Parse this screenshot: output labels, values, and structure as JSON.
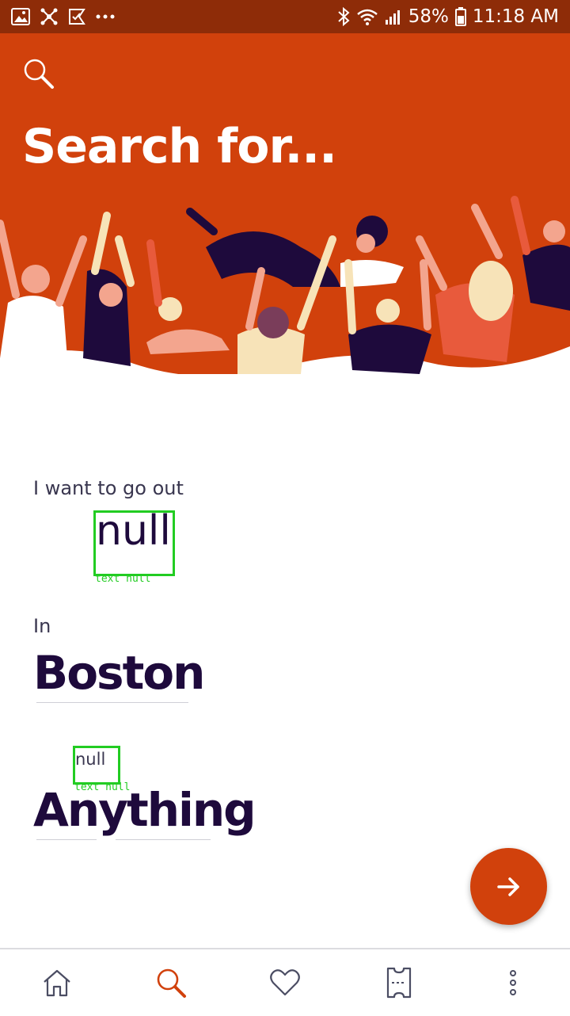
{
  "status_bar": {
    "battery": "58%",
    "time": "11:18 AM"
  },
  "header": {
    "title": "Search for..."
  },
  "form": {
    "go_out_label": "I want to go out",
    "when_value": "null",
    "when_caption": "text null",
    "in_label": "In",
    "location_value": "Boston",
    "category_placeholder": "null",
    "category_caption": "text null",
    "category_value": "Anything"
  },
  "colors": {
    "brand_orange": "#d1410c",
    "status_bar": "#8e2c08",
    "dark_text": "#1e0a3c",
    "debug_green": "#22cc22"
  },
  "bottom_nav": {
    "items": [
      "home-icon",
      "search-icon",
      "heart-icon",
      "ticket-icon",
      "more-icon"
    ],
    "active": "search-icon"
  }
}
